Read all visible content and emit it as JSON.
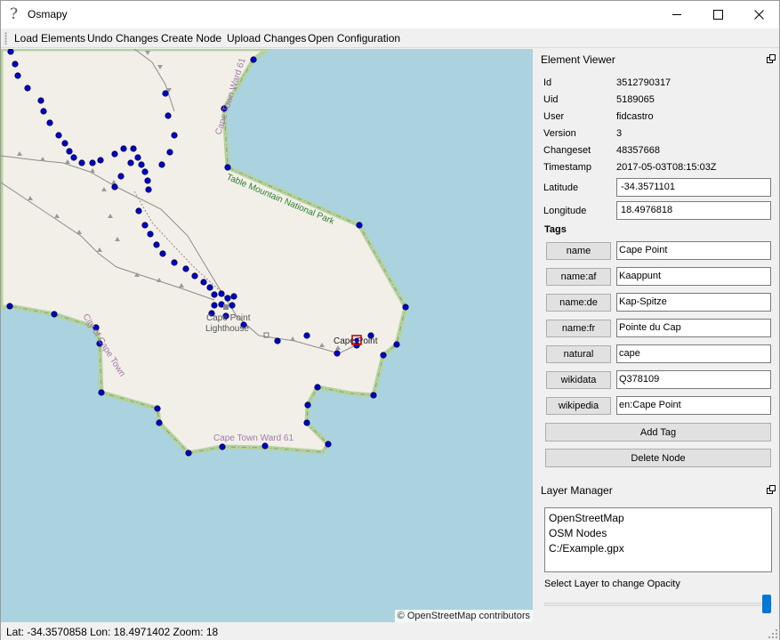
{
  "window": {
    "title": "Osmapy",
    "icon": "question-mark-icon"
  },
  "menubar": [
    "Load Elements",
    "Undo Changes",
    "Create Node",
    "Upload Changes",
    "Open Configuration"
  ],
  "map": {
    "labels": {
      "ward_top": "Cape Town Ward 61",
      "park": "Table Mountain National Park",
      "city": "City of Cape Town",
      "cape_point_line1": "Cape Point",
      "cape_point_line2": "Lighthouse",
      "cape_point_marker": "Cape Point",
      "ward_bottom": "Cape Town Ward 61"
    },
    "attribution": "© OpenStreetMap contributors",
    "colors": {
      "water": "#aad3df",
      "land": "#f2efe9",
      "boundary": "#b5d29f",
      "node": "#0000cc",
      "selected": "#cc0000"
    }
  },
  "element_viewer": {
    "title": "Element Viewer",
    "fields": [
      {
        "label": "Id",
        "value": "3512790317"
      },
      {
        "label": "Uid",
        "value": "5189065"
      },
      {
        "label": "User",
        "value": "fidcastro"
      },
      {
        "label": "Version",
        "value": "3"
      },
      {
        "label": "Changeset",
        "value": "48357668"
      },
      {
        "label": "Timestamp",
        "value": "2017-05-03T08:15:03Z"
      }
    ],
    "latitude": {
      "label": "Latitude",
      "value": "-34.3571101"
    },
    "longitude": {
      "label": "Longitude",
      "value": "18.4976818"
    },
    "tags_heading": "Tags",
    "tags": [
      {
        "key": "name",
        "value": "Cape Point"
      },
      {
        "key": "name:af",
        "value": "Kaappunt"
      },
      {
        "key": "name:de",
        "value": "Kap-Spitze"
      },
      {
        "key": "name:fr",
        "value": "Pointe du Cap"
      },
      {
        "key": "natural",
        "value": "cape"
      },
      {
        "key": "wikidata",
        "value": "Q378109"
      },
      {
        "key": "wikipedia",
        "value": "en:Cape Point"
      }
    ],
    "add_tag": "Add Tag",
    "delete_node": "Delete Node"
  },
  "layer_manager": {
    "title": "Layer Manager",
    "layers": [
      "OpenStreetMap",
      "OSM Nodes",
      "C:/Example.gpx"
    ],
    "opacity_label": "Select Layer to change Opacity",
    "opacity_value": 1.0
  },
  "status": "Lat: -34.3570858 Lon: 18.4971402 Zoom: 18"
}
